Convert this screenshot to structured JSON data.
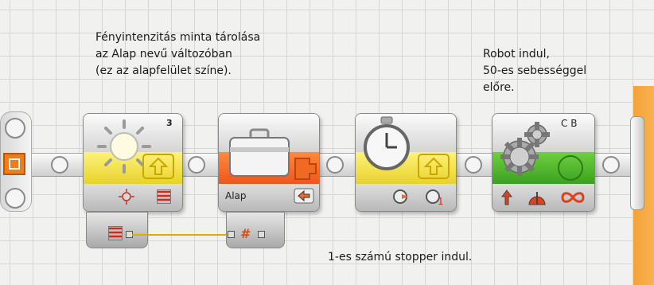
{
  "notes": {
    "light": "Fényintenzitás minta tárolása\naz Alap nevű változóban\n(ez az alapfelület színe).",
    "robot": "Robot indul,\n50-es sebességgel\nelőre.",
    "timer": "1-es számú stopper indul."
  },
  "blocks": {
    "light_sensor": {
      "port": "3",
      "band_color": "#f0dc3c"
    },
    "variable": {
      "name": "Alap",
      "band_color": "#f36a28"
    },
    "timer": {
      "band_color": "#f0dc3c"
    },
    "move": {
      "ports": "C B",
      "band_color": "#4cb82d"
    }
  },
  "hubs": {
    "variable_hash": "#"
  },
  "colors": {
    "wire": "#e4a800",
    "accent_orange": "#f6a23a"
  }
}
